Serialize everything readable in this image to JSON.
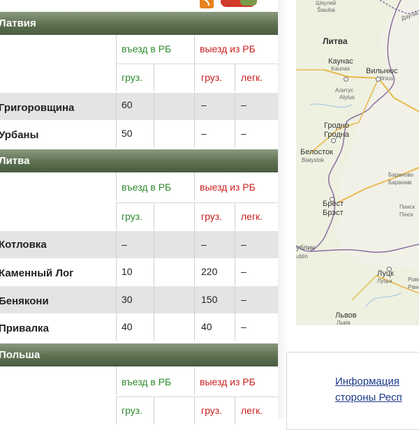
{
  "sections": [
    {
      "name": "Латвия",
      "header": {
        "entry": "въезд в РБ",
        "exit": "выезд из РБ",
        "cargo": "груз.",
        "cargo2": "груз.",
        "light": "легк."
      },
      "rows": [
        {
          "name": "Григоровщина",
          "entry_cargo": "60",
          "exit_cargo": "–",
          "exit_light": "–"
        },
        {
          "name": "Урбаны",
          "entry_cargo": "50",
          "exit_cargo": "–",
          "exit_light": "–"
        }
      ]
    },
    {
      "name": "Литва",
      "header": {
        "entry": "въезд в РБ",
        "exit": "выезд из РБ",
        "cargo": "груз.",
        "cargo2": "груз.",
        "light": "легк."
      },
      "rows": [
        {
          "name": "Котловка",
          "entry_cargo": "–",
          "exit_cargo": "–",
          "exit_light": "–"
        },
        {
          "name": "Каменный Лог",
          "entry_cargo": "10",
          "exit_cargo": "220",
          "exit_light": "–"
        },
        {
          "name": "Бенякони",
          "entry_cargo": "30",
          "exit_cargo": "150",
          "exit_light": "–"
        },
        {
          "name": "Привалка",
          "entry_cargo": "40",
          "exit_cargo": "40",
          "exit_light": "–"
        }
      ]
    },
    {
      "name": "Польша",
      "header": {
        "entry": "въезд в РБ",
        "exit": "выезд из РБ",
        "cargo": "груз.",
        "cargo2": "груз.",
        "light": "легк."
      },
      "rows": []
    }
  ],
  "map": {
    "labels": {
      "country": "Литва",
      "kaunas": "Каунас",
      "kaunas_lt": "Kaunas",
      "vilnius": "Вильнюс",
      "vilnius_lt": "Vilnius",
      "alytus": "Алитус",
      "alytus_lt": "Alytus",
      "grodno": "Гродно",
      "grodna": "Гродна",
      "belostok": "Белосток",
      "bialystok": "Białystok",
      "brest": "Брест",
      "brest2": "Брэст",
      "lublin": "ублин",
      "lublin2": "ublin",
      "lutsk": "Луцк",
      "lutsk2": "Луцьк",
      "lvov": "Львов",
      "lviv": "Львів",
      "siauliai": "Шяуляй",
      "siauliai_lt": "Šiauliai",
      "baranovichi": "Бараново",
      "baranavichy": "Баранаві",
      "pinsk": "Пинск",
      "pinsk2": "Пінск",
      "rovno": "Ровн",
      "rivne": "Рівн",
      "daugava": "Даугав"
    }
  },
  "info": {
    "line1": "Информация",
    "line2": "стороны Респ"
  },
  "colors": {
    "entry": "#2d8a2d",
    "exit": "#c81e1e",
    "section": "#5d7050"
  }
}
